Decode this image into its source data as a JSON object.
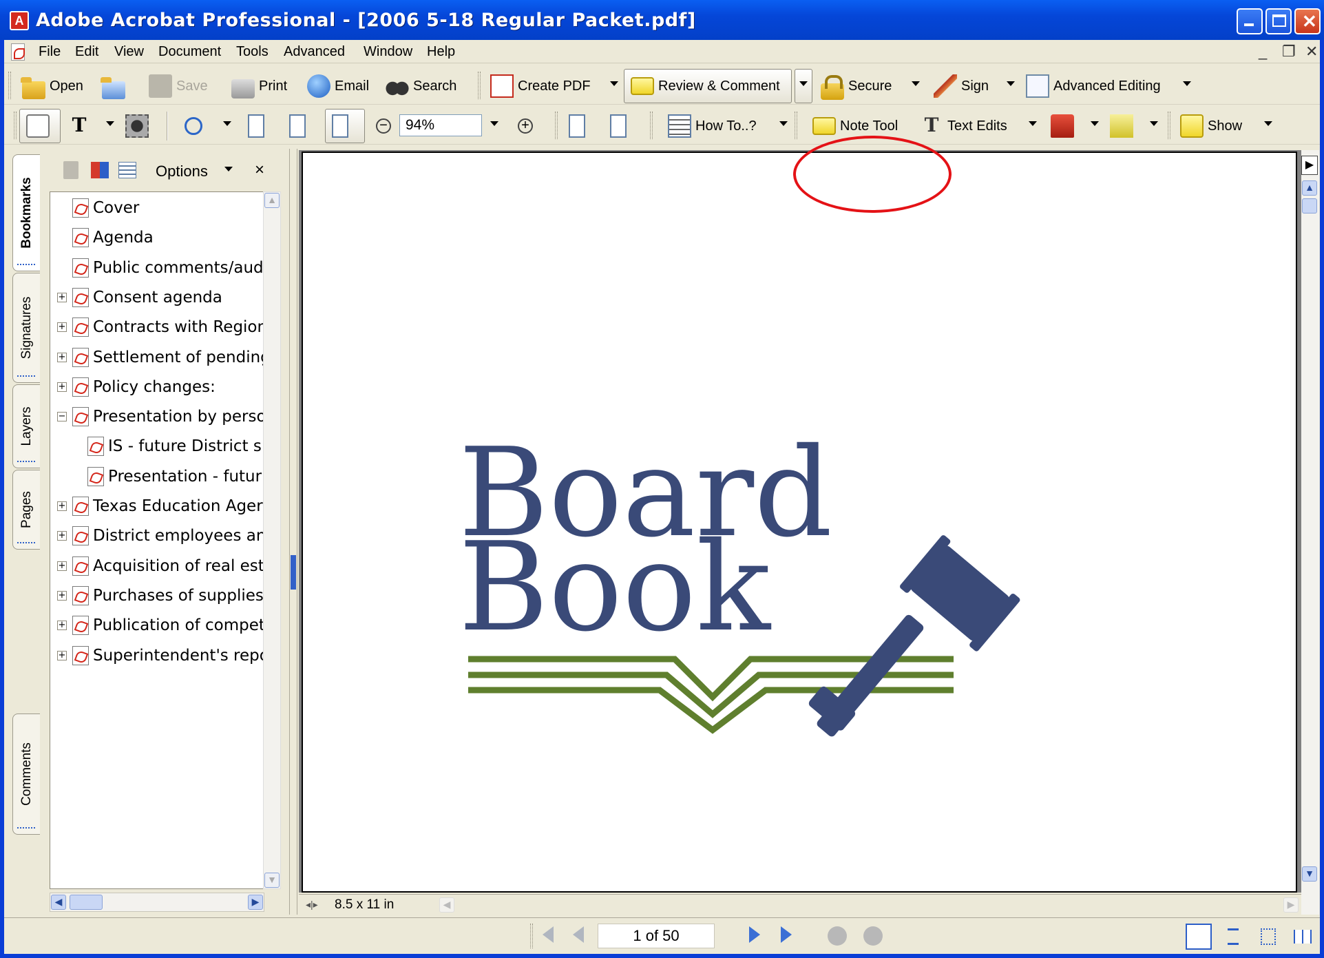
{
  "window": {
    "title": "Adobe Acrobat Professional - [2006 5-18  Regular Packet.pdf]"
  },
  "menubar": {
    "items": [
      "File",
      "Edit",
      "View",
      "Document",
      "Tools",
      "Advanced",
      "Window",
      "Help"
    ]
  },
  "toolbar1": {
    "open": "Open",
    "save": "Save",
    "print": "Print",
    "email": "Email",
    "search": "Search",
    "create_pdf": "Create PDF",
    "review_comment": "Review & Comment",
    "secure": "Secure",
    "sign": "Sign",
    "advanced_editing": "Advanced Editing"
  },
  "toolbar2": {
    "zoom_value": "94%",
    "how_to": "How To..?",
    "note_tool": "Note Tool",
    "text_edits": "Text Edits",
    "show": "Show"
  },
  "sidetabs": [
    "Bookmarks",
    "Signatures",
    "Layers",
    "Pages",
    "Comments"
  ],
  "panel": {
    "options": "Options",
    "close": "×",
    "bookmarks": [
      {
        "label": "Cover",
        "level": 0,
        "expander": ""
      },
      {
        "label": "Agenda",
        "level": 0,
        "expander": ""
      },
      {
        "label": "Public comments/aud",
        "level": 0,
        "expander": ""
      },
      {
        "label": "Consent agenda",
        "level": 0,
        "expander": "+"
      },
      {
        "label": "Contracts with Region",
        "level": 0,
        "expander": "+"
      },
      {
        "label": "Settlement of pending",
        "level": 0,
        "expander": "+"
      },
      {
        "label": "Policy changes:",
        "level": 0,
        "expander": "+"
      },
      {
        "label": "Presentation by perso",
        "level": 0,
        "expander": "−"
      },
      {
        "label": "IS - future District s",
        "level": 1,
        "expander": ""
      },
      {
        "label": "Presentation - futur",
        "level": 1,
        "expander": ""
      },
      {
        "label": "Texas Education Ager",
        "level": 0,
        "expander": "+"
      },
      {
        "label": "District employees an",
        "level": 0,
        "expander": "+"
      },
      {
        "label": "Acquisition of real est",
        "level": 0,
        "expander": "+"
      },
      {
        "label": "Purchases of supplies",
        "level": 0,
        "expander": "+"
      },
      {
        "label": "Publication of compet",
        "level": 0,
        "expander": "+"
      },
      {
        "label": "Superintendent's repo",
        "level": 0,
        "expander": "+"
      }
    ]
  },
  "document": {
    "logo_line1": "Board",
    "logo_line2": "Book",
    "page_size": "8.5 x 11 in",
    "logo_color": "#3a4a78",
    "logo_book_color": "#5f7f2e"
  },
  "statusbar": {
    "page_indicator": "1 of 50"
  },
  "colors": {
    "titlebar": "#0546d8",
    "chrome": "#ece9d8",
    "annotation": "#e41216"
  }
}
